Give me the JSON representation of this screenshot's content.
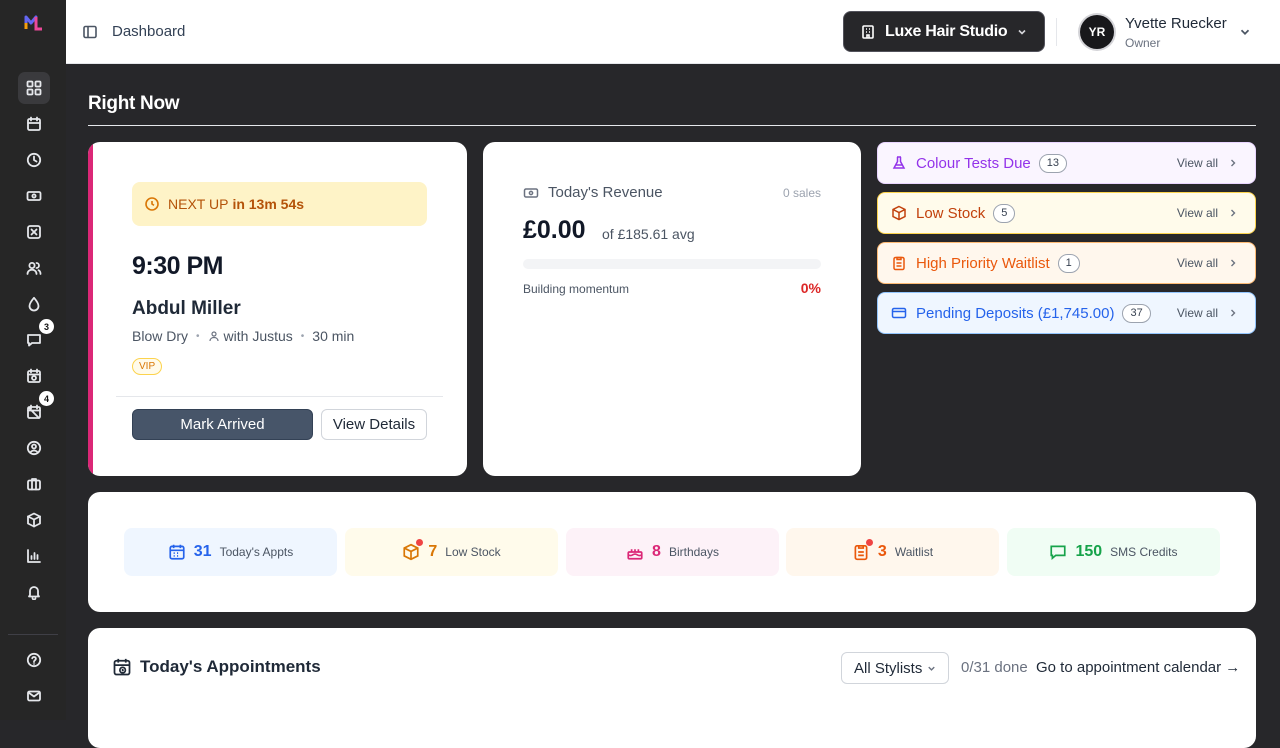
{
  "header": {
    "breadcrumb": "Dashboard",
    "studio_name": "Luxe Hair Studio",
    "user": {
      "initials": "YR",
      "name": "Yvette Ruecker",
      "role": "Owner"
    }
  },
  "sidebar": {
    "badges": {
      "messages": "3",
      "reminders": "4"
    }
  },
  "right_now": {
    "title": "Right Now",
    "next_up": {
      "label": "NEXT UP",
      "countdown": "in 13m 54s",
      "time": "9:30 PM",
      "client": "Abdul Miller",
      "service": "Blow Dry",
      "stylist": "with Justus",
      "duration": "30 min",
      "tag": "VIP",
      "primary_action": "Mark Arrived",
      "secondary_action": "View Details"
    },
    "revenue": {
      "label": "Today's Revenue",
      "sales": "0 sales",
      "amount": "£0.00",
      "average": "of £185.61 avg",
      "progress_fraction": 0,
      "status": "Building momentum",
      "percent": "0%"
    },
    "alerts": [
      {
        "label": "Colour Tests Due",
        "count": "13",
        "action": "View all",
        "icon": "flask-icon"
      },
      {
        "label": "Low Stock",
        "count": "5",
        "action": "View all",
        "icon": "box-icon"
      },
      {
        "label": "High Priority Waitlist",
        "count": "1",
        "action": "View all",
        "icon": "clipboard-icon"
      },
      {
        "label": "Pending Deposits (£1,745.00)",
        "count": "37",
        "action": "View all",
        "icon": "card-icon"
      }
    ]
  },
  "stats": [
    {
      "value": "31",
      "label": "Today's Appts",
      "icon": "calendar-icon"
    },
    {
      "value": "7",
      "label": "Low Stock",
      "icon": "box-icon"
    },
    {
      "value": "8",
      "label": "Birthdays",
      "icon": "cake-icon"
    },
    {
      "value": "3",
      "label": "Waitlist",
      "icon": "clipboard-icon"
    },
    {
      "value": "150",
      "label": "SMS Credits",
      "icon": "message-icon"
    }
  ],
  "appointments": {
    "title": "Today's Appointments",
    "filter": "All Stylists",
    "done": "0/31 done",
    "calendar_link": "Go to appointment calendar →"
  },
  "colors": {
    "brand": "#27272a",
    "next_accent": "#db2777",
    "danger": "#dc2626"
  }
}
